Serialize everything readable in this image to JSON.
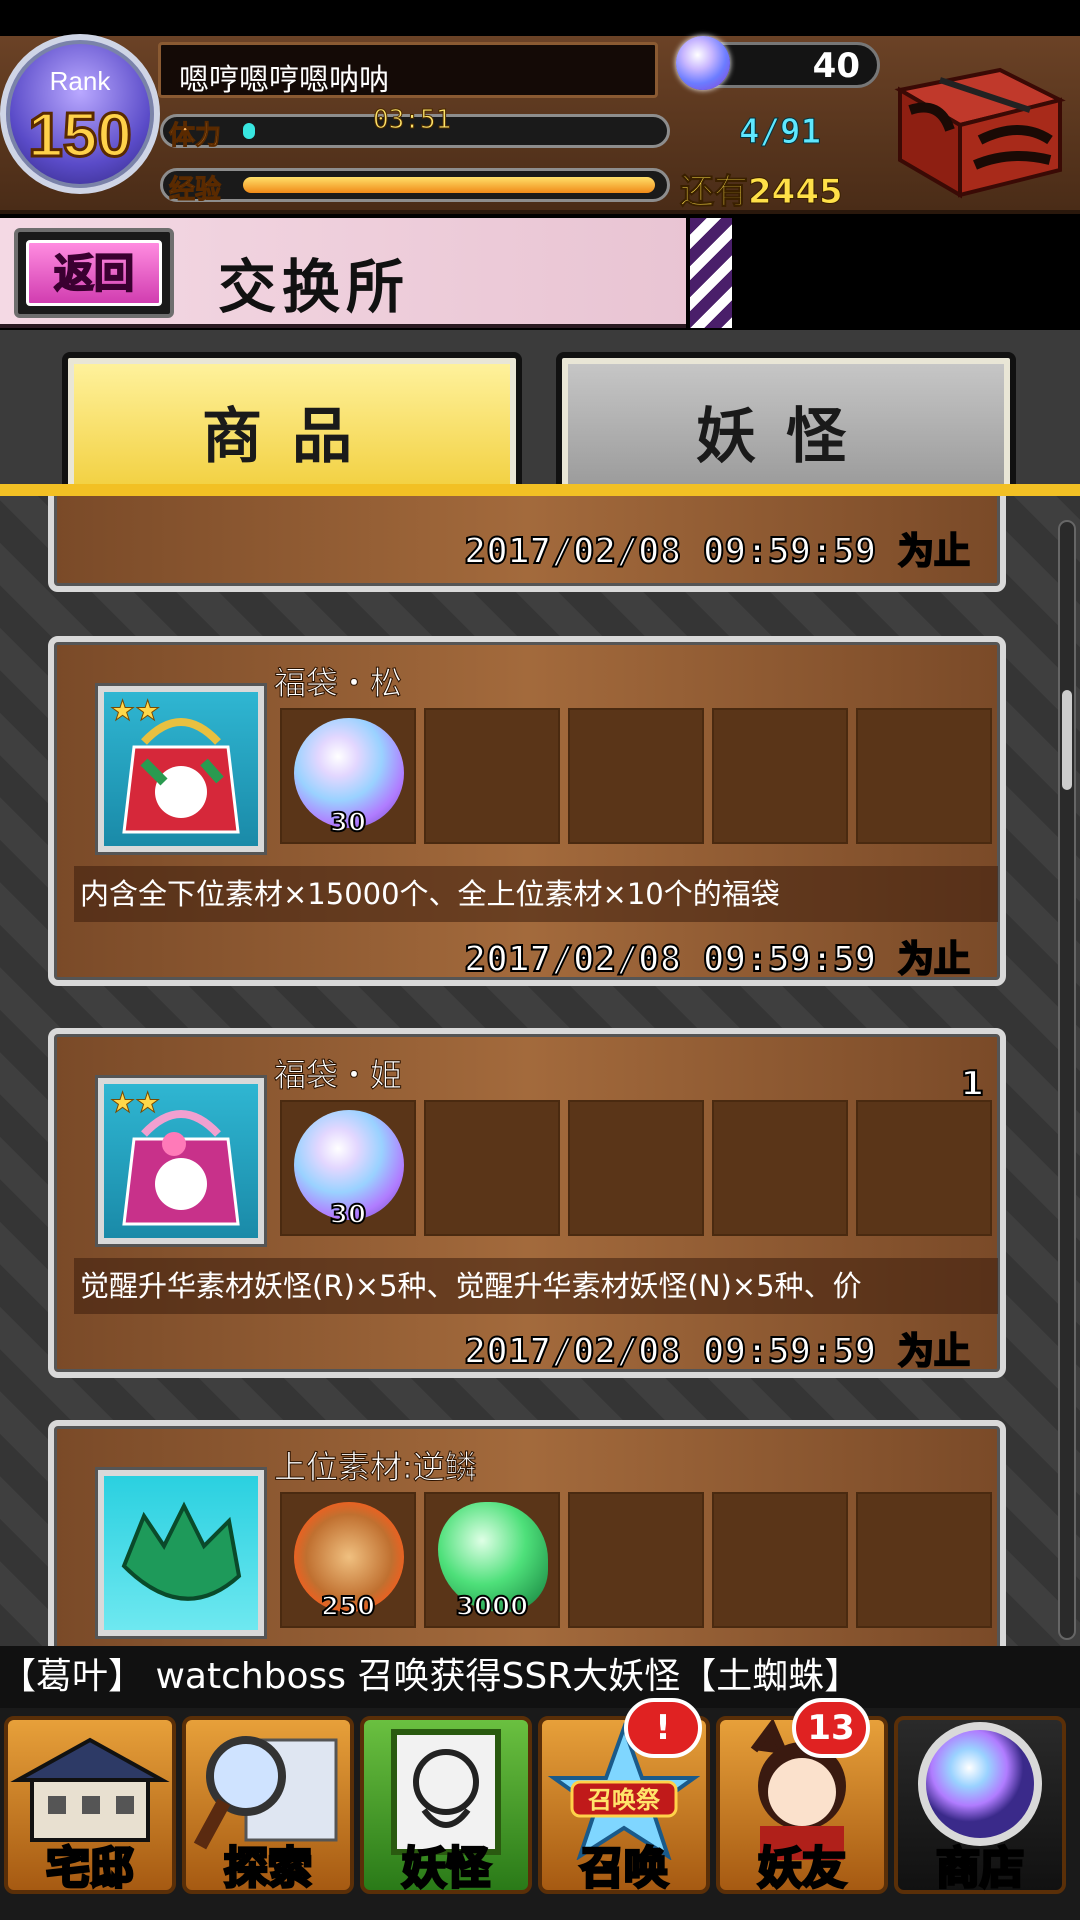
{
  "player": {
    "rank_label": "Rank",
    "rank_value": "150",
    "name": "嗯哼嗯哼嗯呐呐",
    "hp_label": "体力",
    "hp_timer": "03:51",
    "hp_fraction": 0.02,
    "exp_label": "经验",
    "exp_fraction": 0.98,
    "orbs": "40",
    "stamina": "4/91",
    "remaining": "还有2445"
  },
  "header": {
    "back_label": "返回",
    "title": "交换所"
  },
  "tabs": [
    {
      "label": "商品",
      "active": true
    },
    {
      "label": "妖怪",
      "active": false
    }
  ],
  "items": [
    {
      "deadline": "2017/02/08 09:59:59 为止"
    },
    {
      "name": "福袋・松",
      "icon": "lucky-bag-pine-icon",
      "stars": "★★",
      "costs": [
        {
          "icon": "orb-icon",
          "qty": "30"
        }
      ],
      "desc": "内含全下位素材×15000个、全上位素材×10个的福袋",
      "deadline": "2017/02/08 09:59:59 为止"
    },
    {
      "name": "福袋・姫",
      "icon": "lucky-bag-princess-icon",
      "stars": "★★",
      "count": "1",
      "costs": [
        {
          "icon": "orb-icon",
          "qty": "30"
        }
      ],
      "desc": "觉醒升华素材妖怪(R)×5种、觉醒升华素材妖怪(N)×5种、价",
      "deadline": "2017/02/08 09:59:59 为止"
    },
    {
      "name": "上位素材:逆鳞",
      "icon": "dragon-scale-icon",
      "costs": [
        {
          "icon": "coin-icon",
          "qty": "250"
        },
        {
          "icon": "green-gem-icon",
          "qty": "3000"
        }
      ]
    }
  ],
  "ticker": "【葛叶】        watchboss 召唤获得SSR大妖怪【土蜘蛛】",
  "nav": [
    {
      "label": "宅邸",
      "icon": "mansion-icon"
    },
    {
      "label": "探索",
      "icon": "magnifier-map-icon"
    },
    {
      "label": "妖怪",
      "icon": "scroll-icon"
    },
    {
      "label": "召唤",
      "icon": "summon-star-icon",
      "badge": "!",
      "banner": "召唤祭"
    },
    {
      "label": "妖友",
      "icon": "catgirl-icon",
      "badge": "13"
    },
    {
      "label": "商店",
      "icon": "shop-orb-icon"
    }
  ]
}
